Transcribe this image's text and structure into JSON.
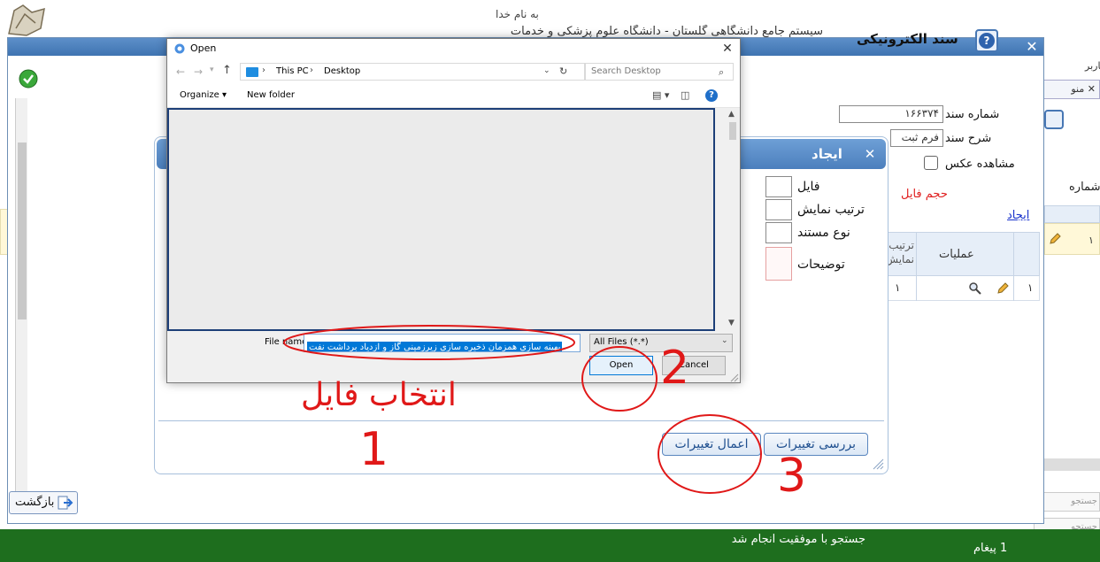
{
  "background": {
    "bismillah": "به نام خدا",
    "subtitle": "سیستم جامع دانشگاهی گلستان - دانشگاه علوم پزشکی و خدمات",
    "user_label": "کاربر",
    "menu_tab": "منو",
    "number_label": "شماره",
    "row_index": "١",
    "search_label": "جستجو"
  },
  "main_form": {
    "title": "سند الکترونیکی",
    "doc_number_label": "شماره سند",
    "doc_number_value": "١۶۶٣٧۴",
    "doc_desc_label": "شرح سند",
    "doc_desc_value": "فرم ثبت",
    "photo_label": "مشاهده عکس",
    "file_size_label": "حجم فایل",
    "create_link": "ایجاد",
    "table": {
      "col_operations": "عملیات",
      "col_order": "ترتیب نمایش",
      "row_order": "١",
      "row_index": "١"
    }
  },
  "create_dialog": {
    "title": "ایجاد",
    "file_label": "فایل",
    "order_label": "ترتیب نمایش",
    "type_label": "نوع مستند",
    "desc_label": "توضیحات",
    "review_button": "بررسی تغییرات",
    "apply_button": "اعمال تغییرات"
  },
  "open_dialog": {
    "title": "Open",
    "path_root": "This PC",
    "path_folder": "Desktop",
    "search_placeholder": "Search Desktop",
    "organize": "Organize ▾",
    "new_folder": "New folder",
    "file_name_label": "File name:",
    "file_name_value": "بهینه سازی همزمان ذخیره سازی زیرزمینی گاز و ازدیاد برداشت نفت",
    "file_type": "All Files (*.*)",
    "open_button": "Open",
    "cancel_button": "Cancel"
  },
  "annotations": {
    "select_file": "انتخاب فایل",
    "step1": "1",
    "step2": "2",
    "step3": "3",
    "color": "#e01818"
  },
  "footer": {
    "back_button": "بازگشت",
    "status_message": "جستجو با موفقیت انجام شد",
    "message_count": "1 پیغام"
  }
}
